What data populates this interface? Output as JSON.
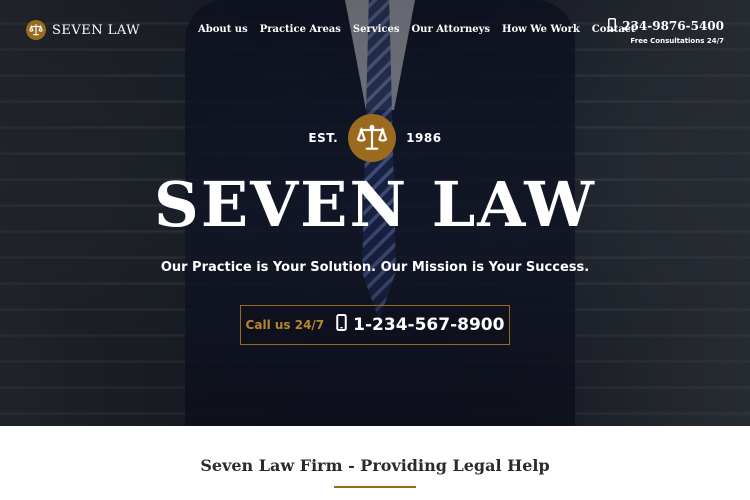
{
  "brand": {
    "name": "SEVEN LAW",
    "icon": "scales-of-justice-icon",
    "accent": "#9a6a1f"
  },
  "nav": {
    "items": [
      {
        "label": "About us"
      },
      {
        "label": "Practice Areas"
      },
      {
        "label": "Services"
      },
      {
        "label": "Our Attorneys"
      },
      {
        "label": "How We Work"
      },
      {
        "label": "Contact"
      }
    ]
  },
  "header_phone": {
    "number": "234-9876-5400",
    "note": "Free Consultations 24/7",
    "icon": "mobile-phone-icon"
  },
  "hero": {
    "est_label": "EST.",
    "est_year": "1986",
    "title": "SEVEN LAW",
    "tagline": "Our Practice is Your Solution. Our Mission is Your Success.",
    "cta": {
      "call_label": "Call us 24/7",
      "number": "1-234-567-8900",
      "icon": "mobile-phone-icon"
    }
  },
  "intro": {
    "heading": "Seven Law Firm - Providing Legal Help"
  }
}
